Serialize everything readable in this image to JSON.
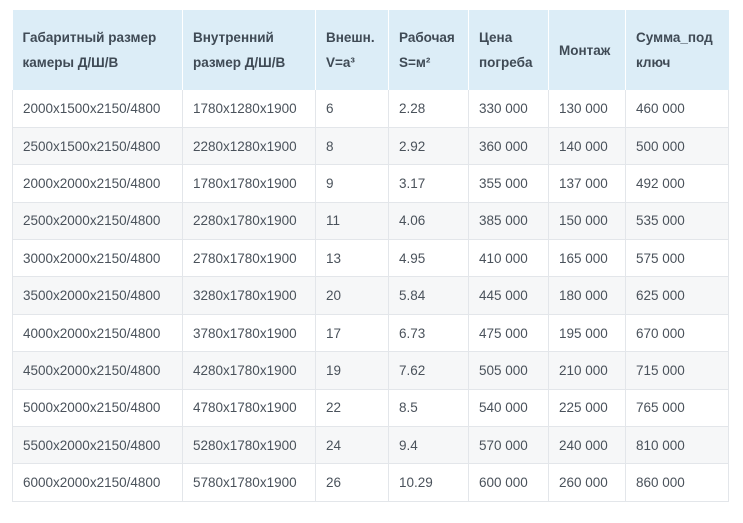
{
  "table": {
    "headers": [
      "Габаритный размер камеры Д/Ш/В",
      "Внутренний размер Д/Ш/В",
      "Внешн. V=a³",
      "Рабочая S=м²",
      "Цена погреба",
      "Монтаж",
      "Сумма_под ключ"
    ],
    "rows": [
      [
        "2000x1500x2150/4800",
        "1780x1280x1900",
        "6",
        "2.28",
        "330 000",
        "130 000",
        "460 000"
      ],
      [
        "2500x1500x2150/4800",
        "2280x1280x1900",
        "8",
        "2.92",
        "360 000",
        "140 000",
        "500 000"
      ],
      [
        "2000x2000x2150/4800",
        "1780x1780x1900",
        "9",
        "3.17",
        "355 000",
        "137 000",
        "492 000"
      ],
      [
        "2500x2000x2150/4800",
        "2280x1780x1900",
        "11",
        "4.06",
        "385 000",
        "150 000",
        "535 000"
      ],
      [
        "3000x2000x2150/4800",
        "2780x1780x1900",
        "13",
        "4.95",
        "410 000",
        "165 000",
        "575 000"
      ],
      [
        "3500x2000x2150/4800",
        "3280x1780x1900",
        "20",
        "5.84",
        "445 000",
        "180 000",
        "625 000"
      ],
      [
        "4000x2000x2150/4800",
        "3780x1780x1900",
        "17",
        "6.73",
        "475 000",
        "195 000",
        "670 000"
      ],
      [
        "4500x2000x2150/4800",
        "4280x1780x1900",
        "19",
        "7.62",
        "505 000",
        "210 000",
        "715 000"
      ],
      [
        "5000x2000x2150/4800",
        "4780x1780x1900",
        "22",
        "8.5",
        "540 000",
        "225 000",
        "765 000"
      ],
      [
        "5500x2000x2150/4800",
        "5280x1780x1900",
        "24",
        "9.4",
        "570 000",
        "240 000",
        "810 000"
      ],
      [
        "6000x2000x2150/4800",
        "5780x1780x1900",
        "26",
        "10.29",
        "600 000",
        "260 000",
        "860 000"
      ]
    ]
  },
  "colors": {
    "header_bg": "#dcedf7",
    "row_alt_bg": "#f6f7f8",
    "border": "#e3e6ea",
    "text": "#4a525b"
  }
}
